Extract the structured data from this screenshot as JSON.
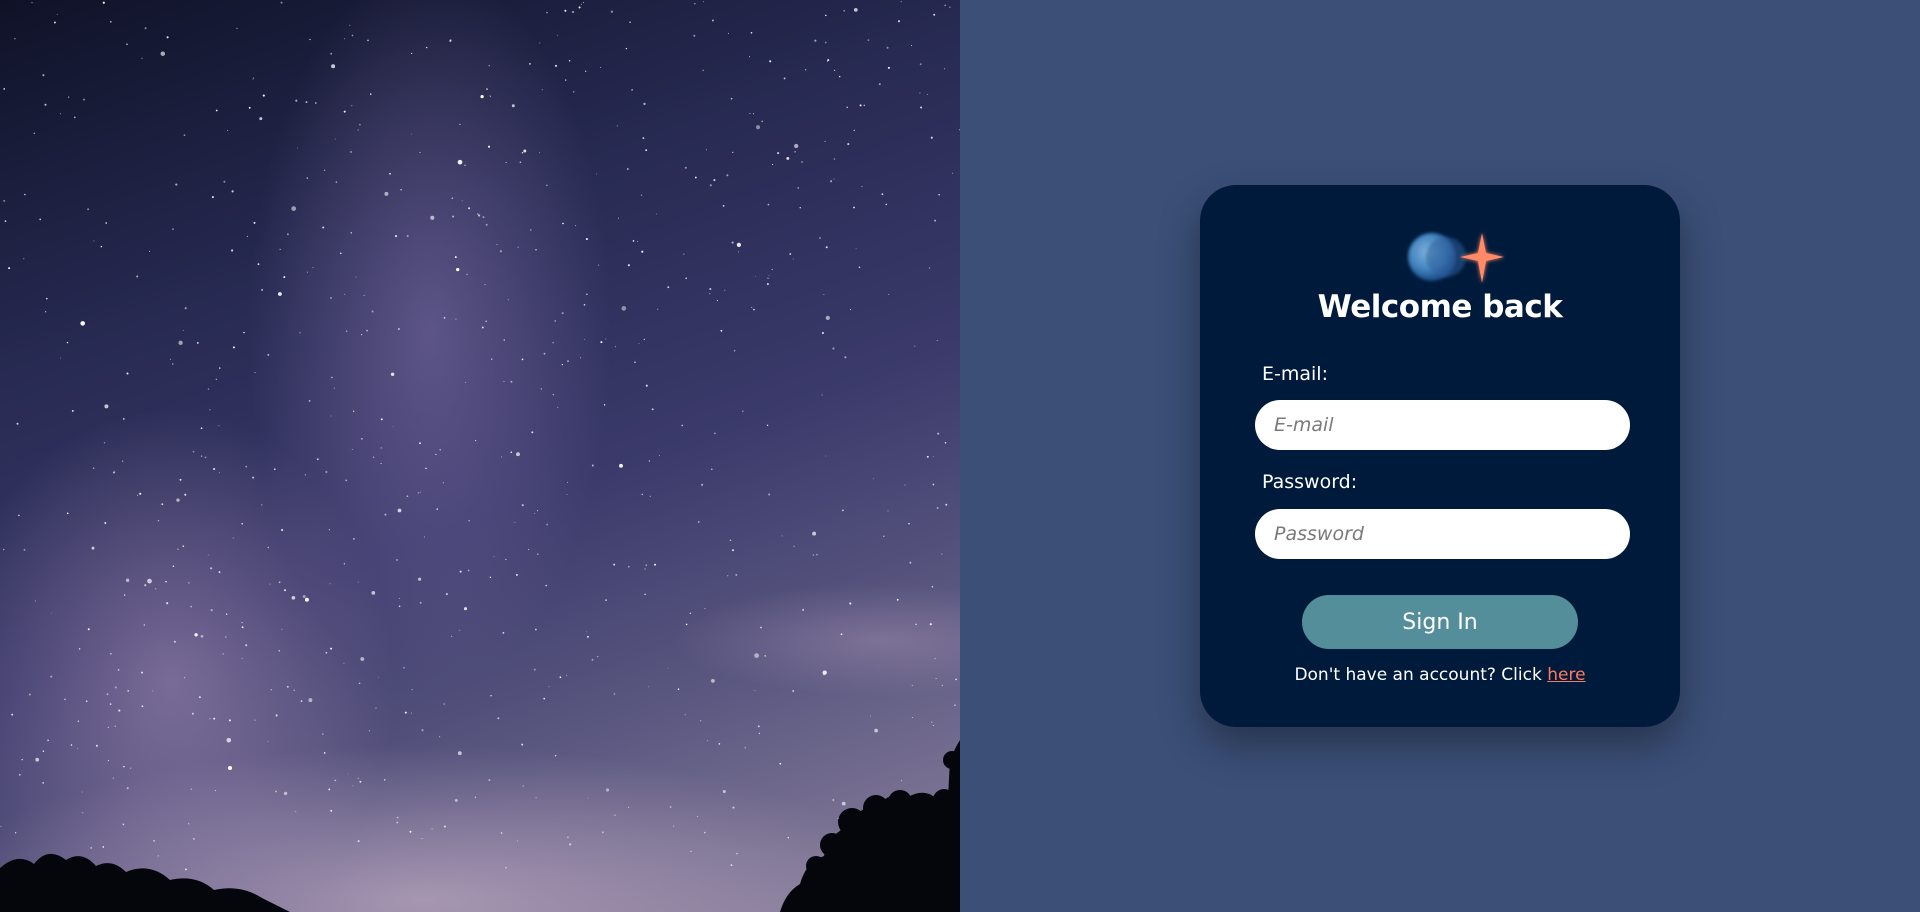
{
  "background": {
    "image": "night-sky-milky-way",
    "colors": {
      "panel": "#3b4f77",
      "card": "#001a3b",
      "button": "#558e9b",
      "link": "#ff7a5f"
    }
  },
  "logo": {
    "icon": "blue-orb-and-orange-sparkle-logo"
  },
  "login": {
    "title": "Welcome back",
    "email_label": "E-mail:",
    "email_placeholder": "E-mail",
    "email_value": "",
    "password_label": "Password:",
    "password_placeholder": "Password",
    "password_value": "",
    "signin_label": "Sign In",
    "signup_text": "Don't have an account? Click ",
    "signup_link_label": "here"
  }
}
